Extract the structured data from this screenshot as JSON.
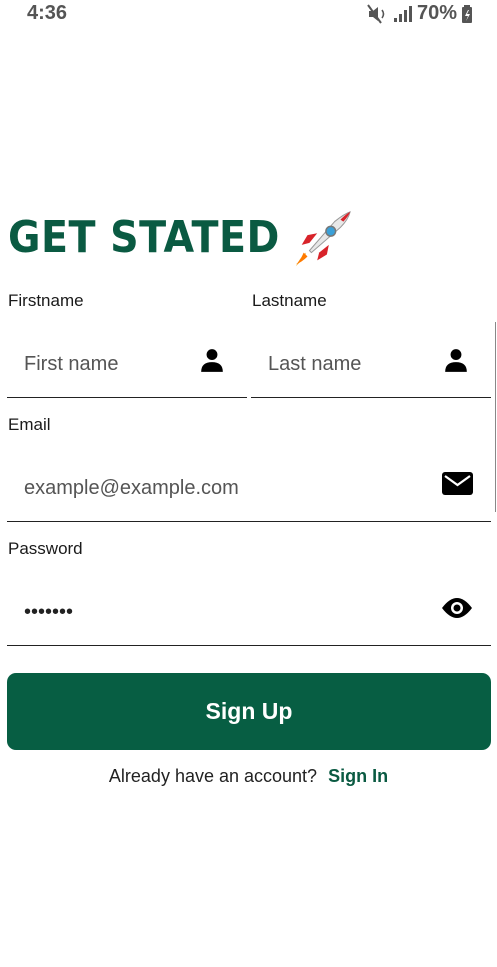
{
  "status_bar": {
    "time": "4:36",
    "battery": "70%"
  },
  "header": {
    "title": "GET STATED"
  },
  "form": {
    "firstname": {
      "label": "Firstname",
      "placeholder": "First name"
    },
    "lastname": {
      "label": "Lastname",
      "placeholder": "Last name"
    },
    "email": {
      "label": "Email",
      "placeholder": "example@example.com"
    },
    "password": {
      "label": "Password",
      "value": "*******"
    }
  },
  "actions": {
    "signup_label": "Sign Up",
    "account_prompt": "Already have an account?",
    "signin_label": "Sign In"
  },
  "colors": {
    "brand": "#075e43",
    "title": "#0a5a42"
  },
  "icons": [
    "mute-icon",
    "signal-icon",
    "battery-icon",
    "rocket-icon",
    "person-icon",
    "mail-icon",
    "eye-icon"
  ]
}
